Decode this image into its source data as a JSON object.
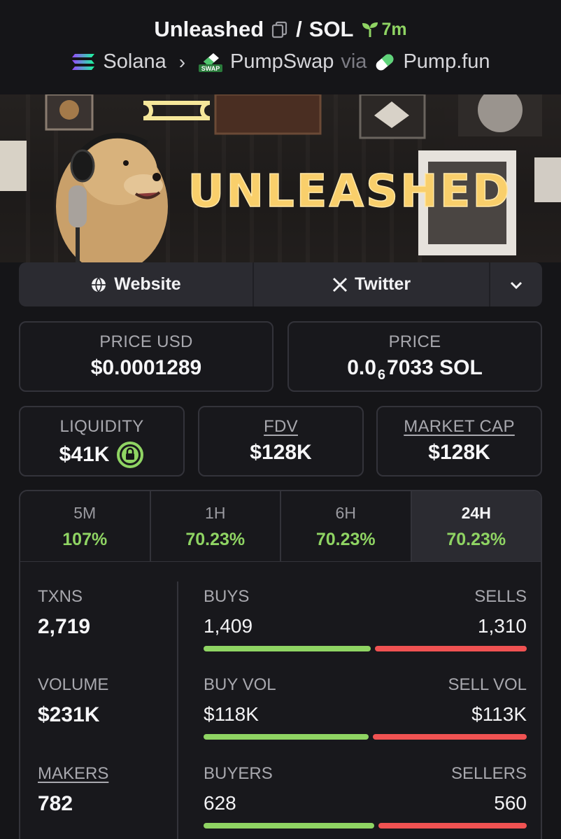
{
  "header": {
    "token_name": "Unleashed",
    "separator": "/",
    "quote_token": "SOL",
    "age": "7m",
    "chain": "Solana",
    "dex": "PumpSwap",
    "dex_badge": "SWAP",
    "via_label": "via",
    "launchpad": "Pump.fun"
  },
  "banner": {
    "text": "UNLEASHED"
  },
  "links": {
    "website": "Website",
    "twitter": "Twitter"
  },
  "price_usd": {
    "label": "PRICE USD",
    "value": "$0.0001289"
  },
  "price": {
    "label": "PRICE",
    "prefix": "0.0",
    "zeros": "6",
    "suffix": "7033 SOL"
  },
  "liquidity": {
    "label": "LIQUIDITY",
    "value": "$41K"
  },
  "fdv": {
    "label": "FDV",
    "value": "$128K"
  },
  "market_cap": {
    "label": "MARKET CAP",
    "value": "$128K"
  },
  "timeframes": [
    {
      "label": "5M",
      "change": "107%"
    },
    {
      "label": "1H",
      "change": "70.23%"
    },
    {
      "label": "6H",
      "change": "70.23%"
    },
    {
      "label": "24H",
      "change": "70.23%"
    }
  ],
  "stats": {
    "txns": {
      "label": "TXNS",
      "value": "2,719"
    },
    "volume": {
      "label": "VOLUME",
      "value": "$231K"
    },
    "makers": {
      "label": "MAKERS",
      "value": "782"
    },
    "buys": {
      "label": "BUYS",
      "value": "1,409"
    },
    "sells": {
      "label": "SELLS",
      "value": "1,310"
    },
    "buy_vol": {
      "label": "BUY VOL",
      "value": "$118K"
    },
    "sell_vol": {
      "label": "SELL VOL",
      "value": "$113K"
    },
    "buyers": {
      "label": "BUYERS",
      "value": "628"
    },
    "sellers": {
      "label": "SELLERS",
      "value": "560"
    },
    "buy_ratio_txns": 0.518,
    "buy_ratio_vol": 0.511,
    "buy_ratio_makers": 0.529
  },
  "colors": {
    "positive": "#8fd463",
    "negative": "#f05252",
    "background": "#151518"
  }
}
